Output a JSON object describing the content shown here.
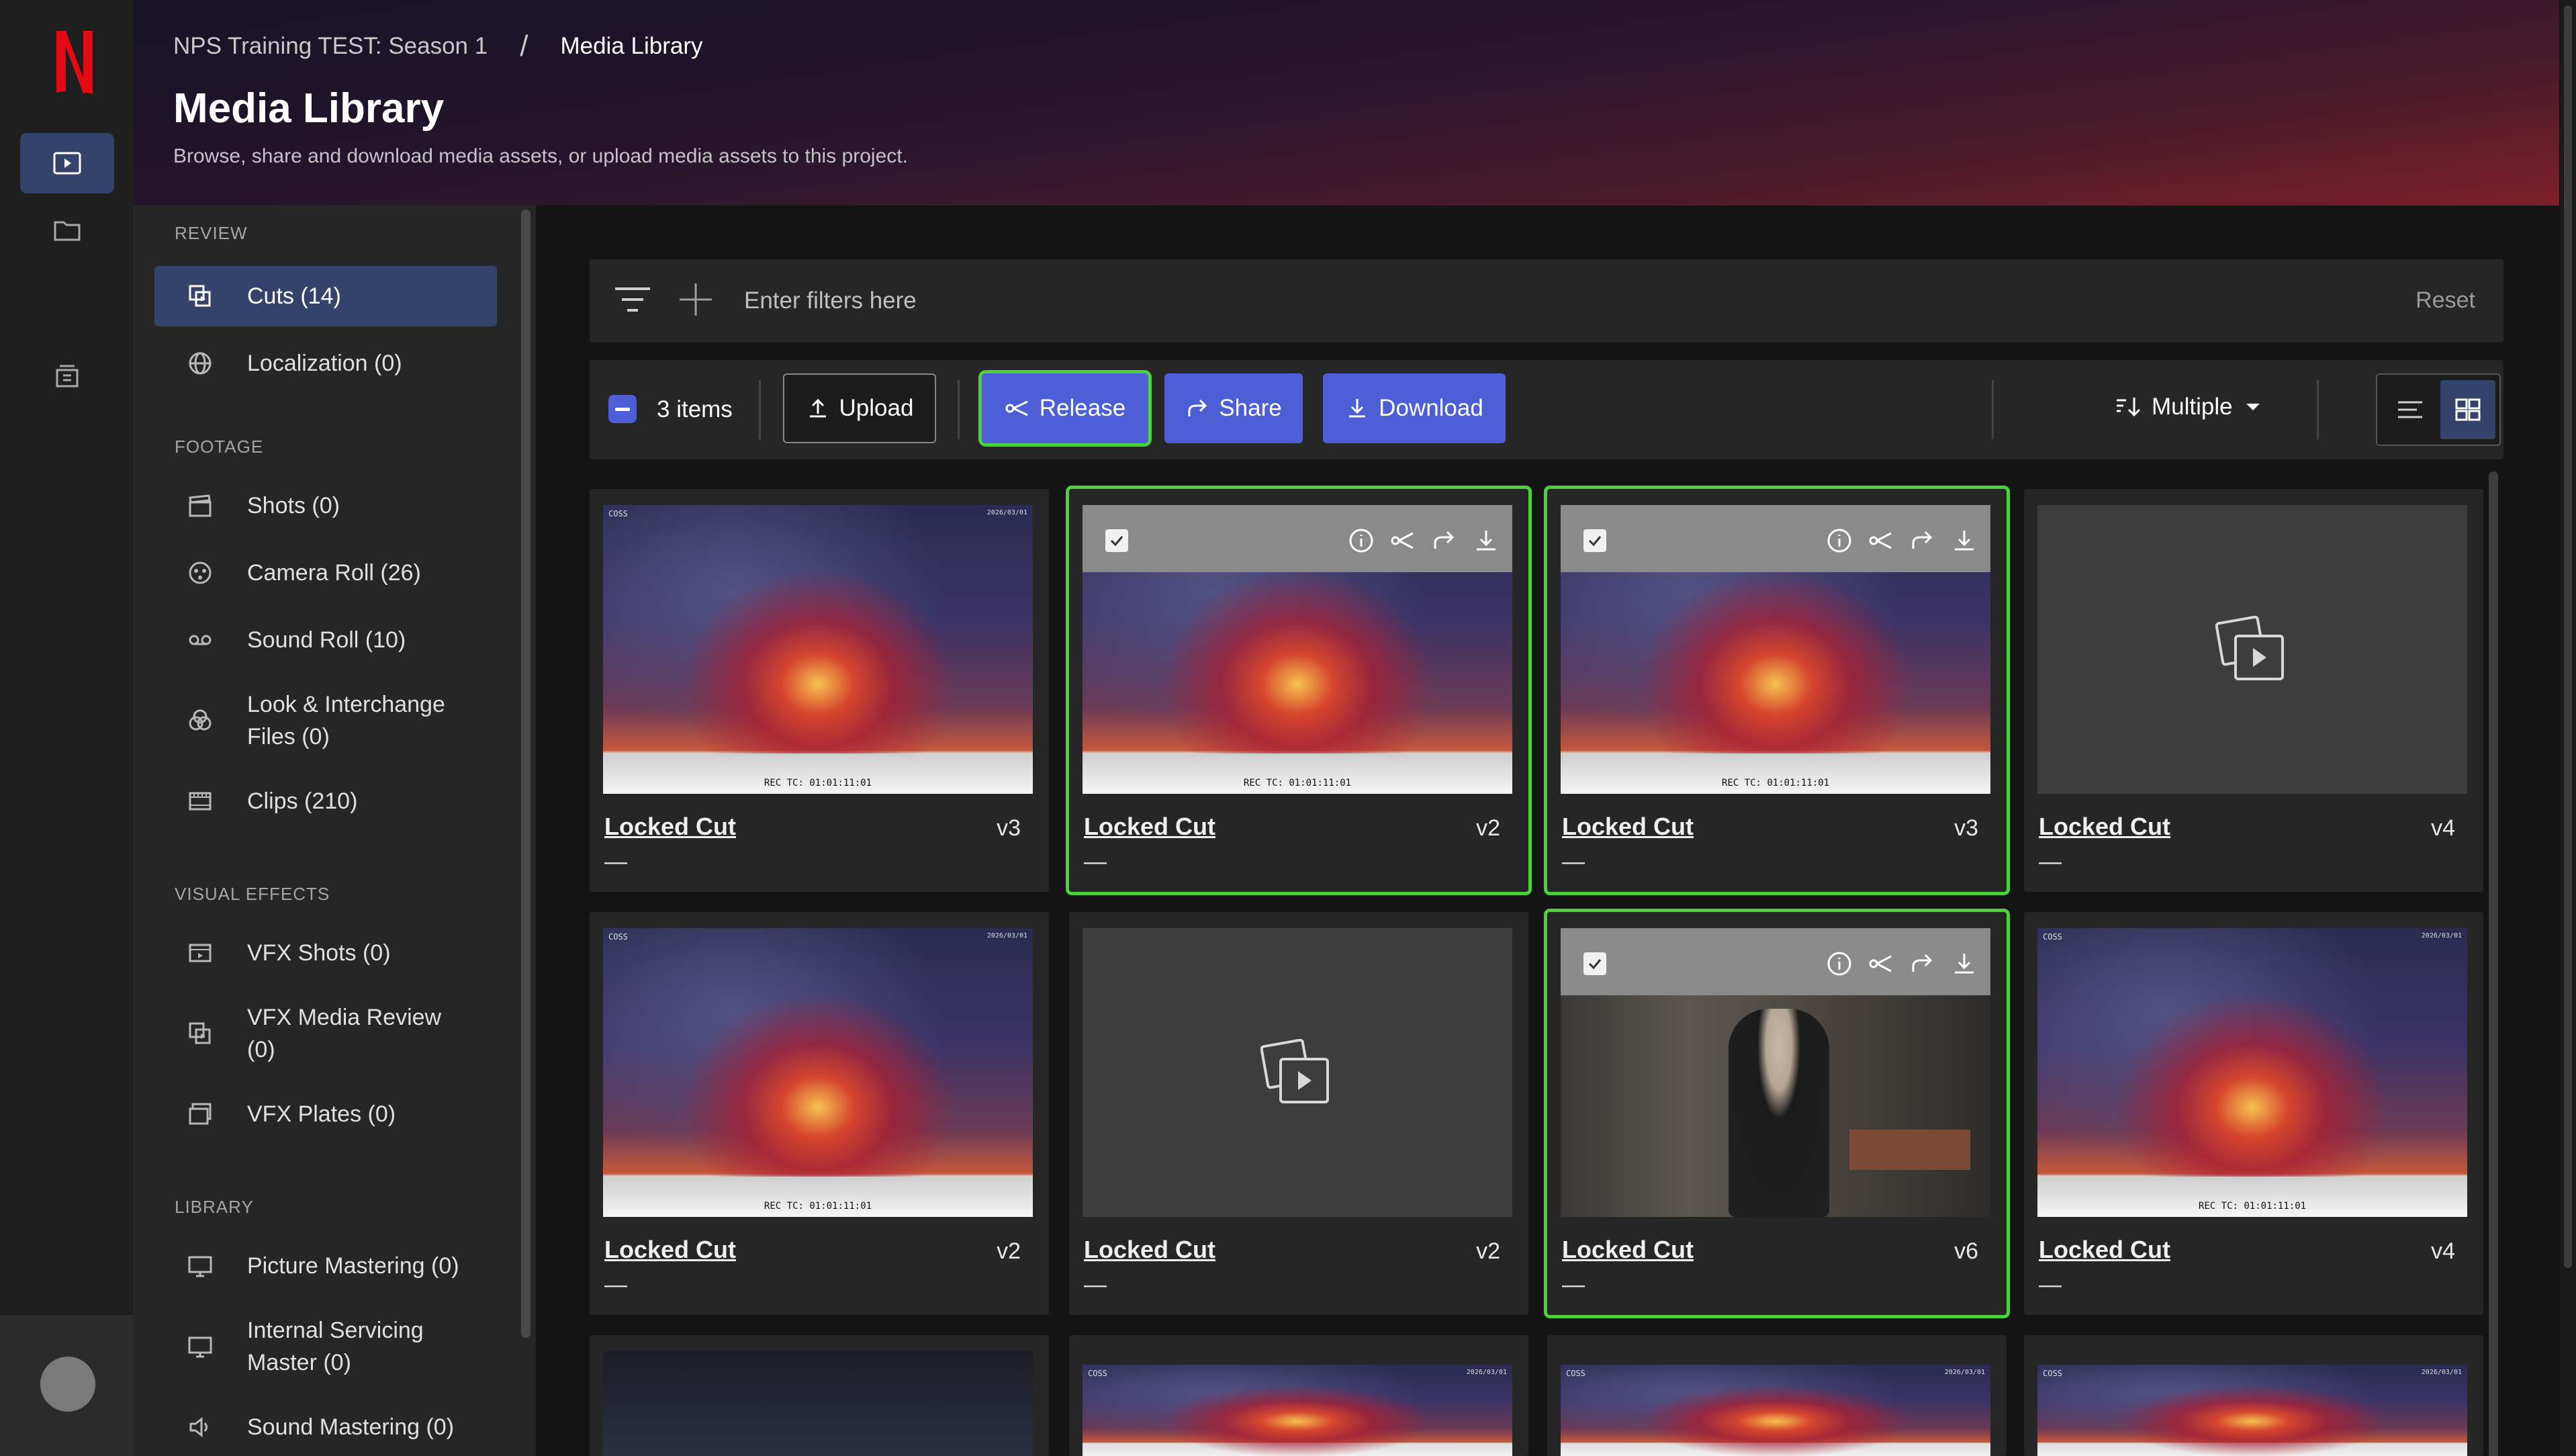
{
  "breadcrumb": {
    "project": "NPS Training TEST: Season 1",
    "separator": "/",
    "current": "Media Library"
  },
  "page": {
    "title": "Media Library",
    "subtitle": "Browse, share and download media assets, or upload media assets to this project."
  },
  "rail": {
    "logo": "N",
    "items": [
      "play-media-icon",
      "folder-icon",
      "archive-box-icon"
    ]
  },
  "sidebar": {
    "sections": {
      "review": "REVIEW",
      "footage": "FOOTAGE",
      "vfx": "VISUAL EFFECTS",
      "library": "LIBRARY"
    },
    "items": {
      "cuts": "Cuts (14)",
      "localization": "Localization (0)",
      "shots": "Shots (0)",
      "camera_roll": "Camera Roll (26)",
      "sound_roll": "Sound Roll (10)",
      "look": "Look & Interchange Files (0)",
      "clips": "Clips (210)",
      "vfx_shots": "VFX Shots (0)",
      "vfx_review": "VFX Media Review (0)",
      "vfx_plates": "VFX Plates (0)",
      "picture_mastering": "Picture Mastering (0)",
      "internal_servicing": "Internal Servicing Master (0)",
      "sound_mastering": "Sound Mastering (0)"
    }
  },
  "filter": {
    "placeholder": "Enter filters here",
    "reset": "Reset"
  },
  "toolbar": {
    "count": "3 items",
    "upload": "Upload",
    "release": "Release",
    "share": "Share",
    "download": "Download",
    "sort": "Multiple"
  },
  "art": {
    "tc": "REC TC: 01:01:11:01",
    "corner_l": "COSS",
    "corner_r": "2026/03/01"
  },
  "cards": [
    {
      "title": "Locked Cut",
      "version": "v3",
      "meta": "—"
    },
    {
      "title": "Locked Cut",
      "version": "v2",
      "meta": "—"
    },
    {
      "title": "Locked Cut",
      "version": "v3",
      "meta": "—"
    },
    {
      "title": "Locked Cut",
      "version": "v4",
      "meta": "—"
    },
    {
      "title": "Locked Cut",
      "version": "v2",
      "meta": "—"
    },
    {
      "title": "Locked Cut",
      "version": "v2",
      "meta": "—"
    },
    {
      "title": "Locked Cut",
      "version": "v6",
      "meta": "—"
    },
    {
      "title": "Locked Cut",
      "version": "v4",
      "meta": "—"
    }
  ],
  "colors": {
    "accent": "#4c5fd6",
    "selected_outline": "#4ed03e",
    "brand": "#e50914"
  }
}
